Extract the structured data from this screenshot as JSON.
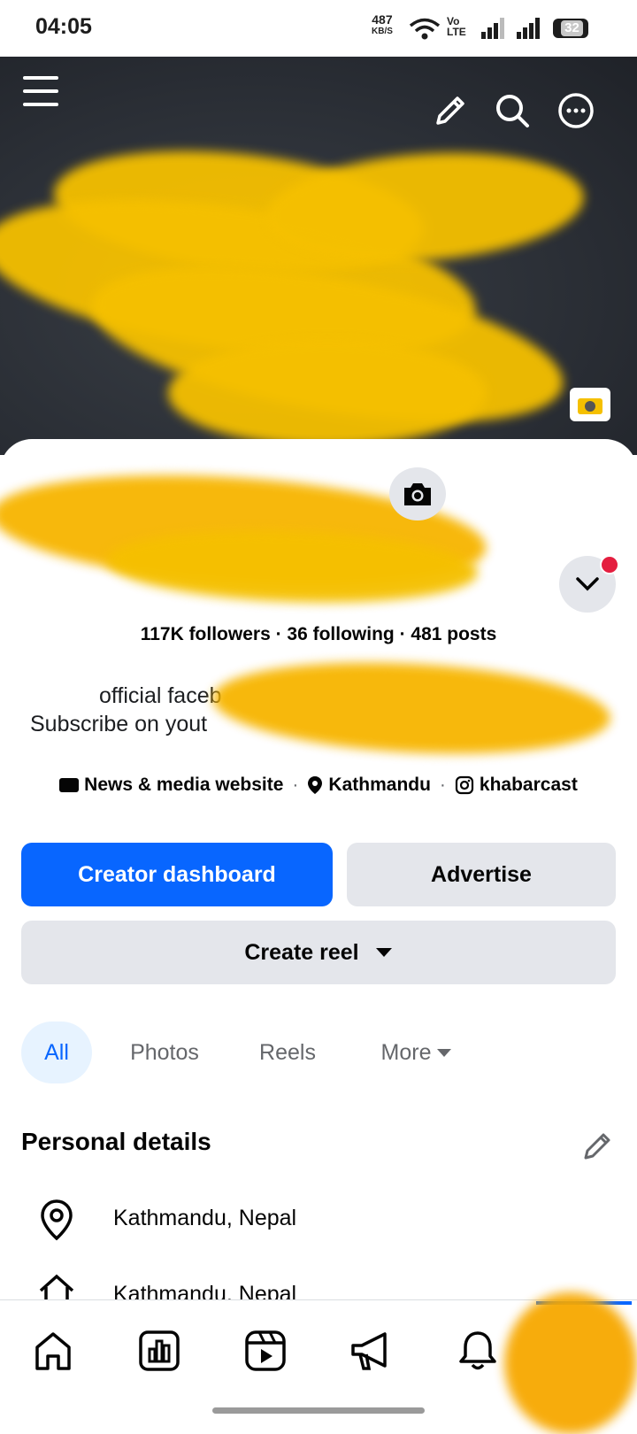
{
  "status_bar": {
    "time": "04:05",
    "net_speed": "487",
    "net_unit": "KB/S",
    "volte": "Vo",
    "lte": "LTE",
    "battery": "32"
  },
  "profile": {
    "stats": "117K followers · 36 following · 481 posts",
    "bio_line1": "official faceb",
    "bio_line2": "Subscribe on yout",
    "category": "News & media website",
    "location": "Kathmandu",
    "instagram": "khabarcast"
  },
  "actions": {
    "creator_dashboard": "Creator dashboard",
    "advertise": "Advertise",
    "create_reel": "Create reel"
  },
  "tabs": [
    {
      "label": "All",
      "active": true
    },
    {
      "label": "Photos",
      "active": false
    },
    {
      "label": "Reels",
      "active": false
    },
    {
      "label": "More",
      "active": false
    }
  ],
  "personal_details": {
    "title": "Personal details",
    "items": [
      {
        "icon": "location-pin-icon",
        "text": "Kathmandu, Nepal"
      },
      {
        "icon": "home-icon",
        "text": "Kathmandu, Nepal"
      }
    ]
  },
  "bottom_nav": [
    "home-icon",
    "dashboard-icon",
    "reels-icon",
    "megaphone-icon",
    "bell-icon"
  ],
  "colors": {
    "primary": "#0866ff",
    "secondary_button": "#e4e6eb",
    "active_tab_bg": "#e7f3ff",
    "redaction": "#f5c000",
    "notification_dot": "#e41e3f"
  }
}
